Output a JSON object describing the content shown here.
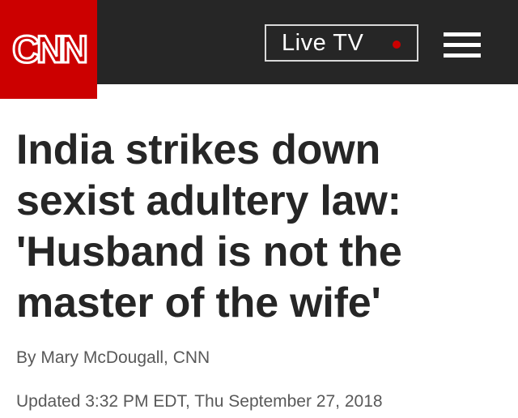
{
  "header": {
    "logo_text": "CNN",
    "live_tv_label": "Live TV",
    "live_indicator_color": "#cc0000",
    "menu_icon": "hamburger-menu-icon"
  },
  "colors": {
    "brand_red": "#cc0000",
    "header_bg": "#262626",
    "headline_text": "#262626",
    "meta_text": "#595959"
  },
  "article": {
    "headline": "India strikes down sexist adultery law: 'Husband is not the master of the wife'",
    "byline": "By Mary McDougall, CNN",
    "updated": "Updated 3:32 PM EDT, Thu September 27, 2018"
  }
}
